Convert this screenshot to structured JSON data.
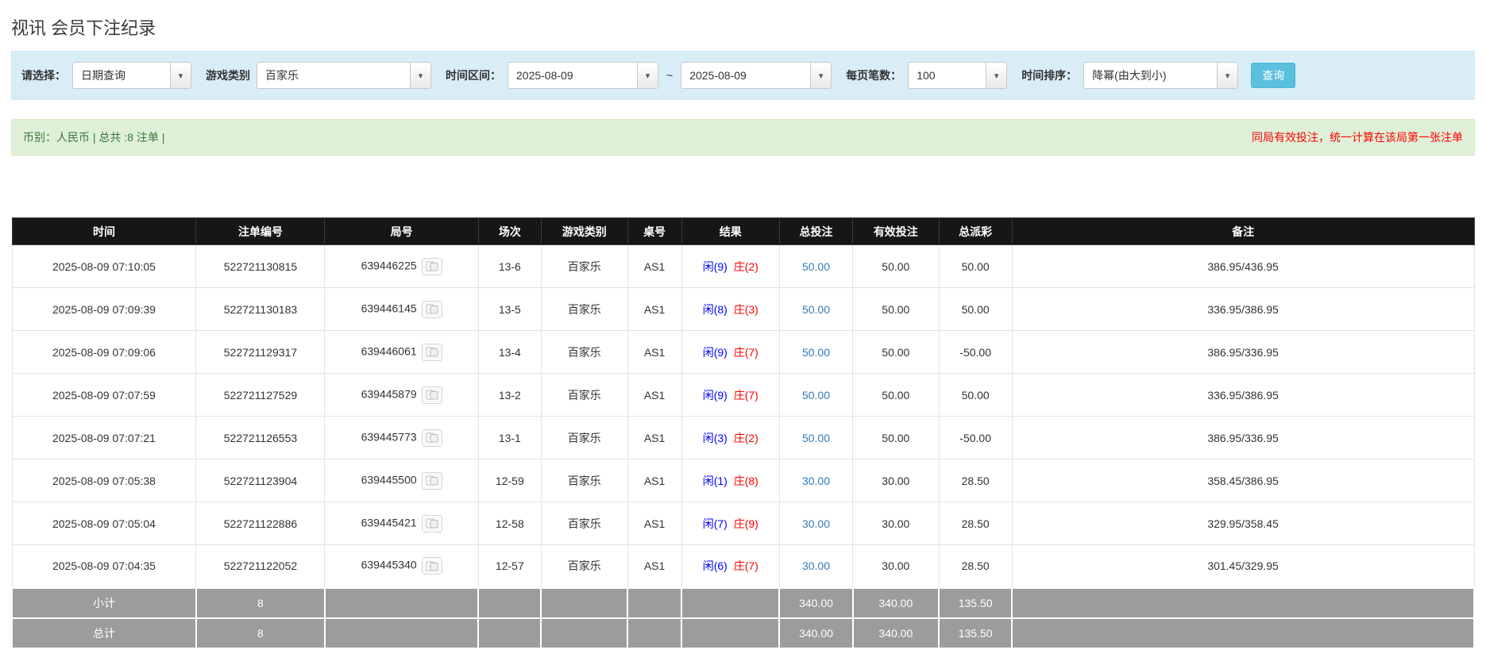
{
  "page": {
    "title": "视讯 会员下注纪录"
  },
  "filters": {
    "select_label": "请选择：",
    "select_value": "日期查询",
    "game_type_label": "游戏类别",
    "game_type_value": "百家乐",
    "time_range_label": "时间区间：",
    "date_from": "2025-08-09",
    "tilde": "~",
    "date_to": "2025-08-09",
    "page_size_label": "每页笔数：",
    "page_size_value": "100",
    "sort_label": "时间排序：",
    "sort_value": "降幂(由大到小)",
    "search_button": "查询"
  },
  "summary": {
    "currency_info": "币别：人民币 | 总共 :8 注单 |",
    "notice": "同局有效投注，统一计算在该局第一张注单"
  },
  "table": {
    "headers": {
      "time": "时间",
      "bet_id": "注单编号",
      "round": "局号",
      "session": "场次",
      "game": "游戏类别",
      "table_no": "桌号",
      "result": "结果",
      "total_bet": "总投注",
      "valid_bet": "有效投注",
      "payout": "总派彩",
      "note": "备注"
    },
    "rows": [
      {
        "time": "2025-08-09 07:10:05",
        "bet_id": "522721130815",
        "round": "639446225",
        "session": "13-6",
        "game": "百家乐",
        "table_no": "AS1",
        "player": "闲(9)",
        "banker": "庄(2)",
        "total_bet": "50.00",
        "valid_bet": "50.00",
        "payout": "50.00",
        "note": "386.95/436.95",
        "highlighted": true
      },
      {
        "time": "2025-08-09 07:09:39",
        "bet_id": "522721130183",
        "round": "639446145",
        "session": "13-5",
        "game": "百家乐",
        "table_no": "AS1",
        "player": "闲(8)",
        "banker": "庄(3)",
        "total_bet": "50.00",
        "valid_bet": "50.00",
        "payout": "50.00",
        "note": "336.95/386.95",
        "highlighted": false
      },
      {
        "time": "2025-08-09 07:09:06",
        "bet_id": "522721129317",
        "round": "639446061",
        "session": "13-4",
        "game": "百家乐",
        "table_no": "AS1",
        "player": "闲(9)",
        "banker": "庄(7)",
        "total_bet": "50.00",
        "valid_bet": "50.00",
        "payout": "-50.00",
        "note": "386.95/336.95",
        "highlighted": false
      },
      {
        "time": "2025-08-09 07:07:59",
        "bet_id": "522721127529",
        "round": "639445879",
        "session": "13-2",
        "game": "百家乐",
        "table_no": "AS1",
        "player": "闲(9)",
        "banker": "庄(7)",
        "total_bet": "50.00",
        "valid_bet": "50.00",
        "payout": "50.00",
        "note": "336.95/386.95",
        "highlighted": false
      },
      {
        "time": "2025-08-09 07:07:21",
        "bet_id": "522721126553",
        "round": "639445773",
        "session": "13-1",
        "game": "百家乐",
        "table_no": "AS1",
        "player": "闲(3)",
        "banker": "庄(2)",
        "total_bet": "50.00",
        "valid_bet": "50.00",
        "payout": "-50.00",
        "note": "386.95/336.95",
        "highlighted": false
      },
      {
        "time": "2025-08-09 07:05:38",
        "bet_id": "522721123904",
        "round": "639445500",
        "session": "12-59",
        "game": "百家乐",
        "table_no": "AS1",
        "player": "闲(1)",
        "banker": "庄(8)",
        "total_bet": "30.00",
        "valid_bet": "30.00",
        "payout": "28.50",
        "note": "358.45/386.95",
        "highlighted": false
      },
      {
        "time": "2025-08-09 07:05:04",
        "bet_id": "522721122886",
        "round": "639445421",
        "session": "12-58",
        "game": "百家乐",
        "table_no": "AS1",
        "player": "闲(7)",
        "banker": "庄(9)",
        "total_bet": "30.00",
        "valid_bet": "30.00",
        "payout": "28.50",
        "note": "329.95/358.45",
        "highlighted": false
      },
      {
        "time": "2025-08-09 07:04:35",
        "bet_id": "522721122052",
        "round": "639445340",
        "session": "12-57",
        "game": "百家乐",
        "table_no": "AS1",
        "player": "闲(6)",
        "banker": "庄(7)",
        "total_bet": "30.00",
        "valid_bet": "30.00",
        "payout": "28.50",
        "note": "301.45/329.95",
        "highlighted": false
      }
    ],
    "subtotal": {
      "label": "小计",
      "count": "8",
      "total_bet": "340.00",
      "valid_bet": "340.00",
      "payout": "135.50"
    },
    "total": {
      "label": "总计",
      "count": "8",
      "total_bet": "340.00",
      "valid_bet": "340.00",
      "payout": "135.50"
    }
  },
  "colors": {
    "accent": "#5bc0de",
    "filter_bg": "#d9edf7",
    "summary_bg": "#dff0d8",
    "header_bg": "#161616",
    "highlight": "#ffff99",
    "link": "#337ab7",
    "player": "#0000ff",
    "banker": "#ff0000",
    "negative": "#ff0000",
    "footer_bg": "#9c9c9c"
  }
}
